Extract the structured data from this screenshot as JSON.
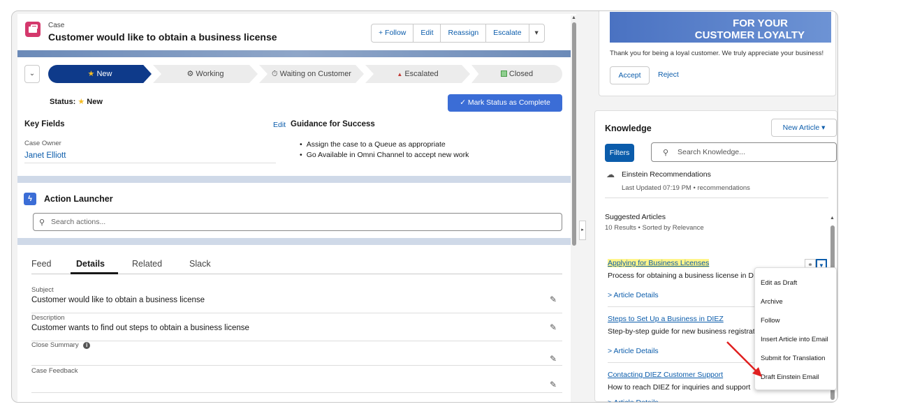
{
  "header": {
    "object_type": "Case",
    "title": "Customer would like to obtain a business license",
    "buttons": {
      "follow": "+ Follow",
      "edit": "Edit",
      "reassign": "Reassign",
      "escalate": "Escalate",
      "more": "▾"
    }
  },
  "path": {
    "stages": [
      {
        "label": "New",
        "icon": "star-icon",
        "active": true
      },
      {
        "label": "Working",
        "icon": "gear-icon",
        "active": false
      },
      {
        "label": "Waiting on Customer",
        "icon": "stopwatch-icon",
        "active": false
      },
      {
        "label": "Escalated",
        "icon": "warning-icon",
        "active": false
      },
      {
        "label": "Closed",
        "icon": "checkbox-icon",
        "active": false
      }
    ],
    "status_label": "Status:",
    "status_value": "New",
    "mark_complete": "✓ Mark Status as Complete"
  },
  "key_fields": {
    "title": "Key Fields",
    "edit": "Edit",
    "case_owner_label": "Case Owner",
    "case_owner": "Janet Elliott"
  },
  "guidance": {
    "title": "Guidance for Success",
    "items": [
      "Assign the case to a Queue as appropriate",
      "Go Available in Omni Channel to accept new work"
    ]
  },
  "action_launcher": {
    "title": "Action Launcher",
    "search_placeholder": "Search actions..."
  },
  "tabs": [
    "Feed",
    "Details",
    "Related",
    "Slack"
  ],
  "details": {
    "subject_label": "Subject",
    "subject": "Customer would like to obtain a business license",
    "description_label": "Description",
    "description": "Customer wants to find out steps to obtain a business license",
    "close_summary_label": "Close Summary",
    "case_feedback_label": "Case Feedback"
  },
  "loyalty": {
    "banner_line1": "FOR YOUR",
    "banner_line2": "CUSTOMER LOYALTY",
    "message": "Thank you for being a loyal customer. We truly appreciate your business!",
    "accept": "Accept",
    "reject": "Reject"
  },
  "knowledge": {
    "title": "Knowledge",
    "new_article": "New Article ▾",
    "filters": "Filters",
    "search_placeholder": "Search Knowledge...",
    "einstein_title": "Einstein Recommendations",
    "einstein_sub": "Last Updated 07:19 PM • recommendations",
    "suggested_title": "Suggested Articles",
    "suggested_sub": "10 Results • Sorted by Relevance",
    "details_link": "> Article Details",
    "articles": [
      {
        "title": "Applying for Business Licenses",
        "desc": "Process for obtaining a business license in DIEZ"
      },
      {
        "title": "Steps to Set Up a Business in DIEZ",
        "desc": "Step-by-step guide for new business registration"
      },
      {
        "title": "Contacting DIEZ Customer Support",
        "desc": "How to reach DIEZ for inquiries and support"
      }
    ],
    "menu": [
      "Edit as Draft",
      "Archive",
      "Follow",
      "Insert Article into Email",
      "Submit for Translation",
      "Draft Einstein Email"
    ]
  },
  "colors": {
    "accent": "#0b5cab",
    "path_active": "#0e3a8a",
    "case_icon": "#d4386c",
    "highlight": "#fff58a",
    "arrow": "#e02020"
  }
}
